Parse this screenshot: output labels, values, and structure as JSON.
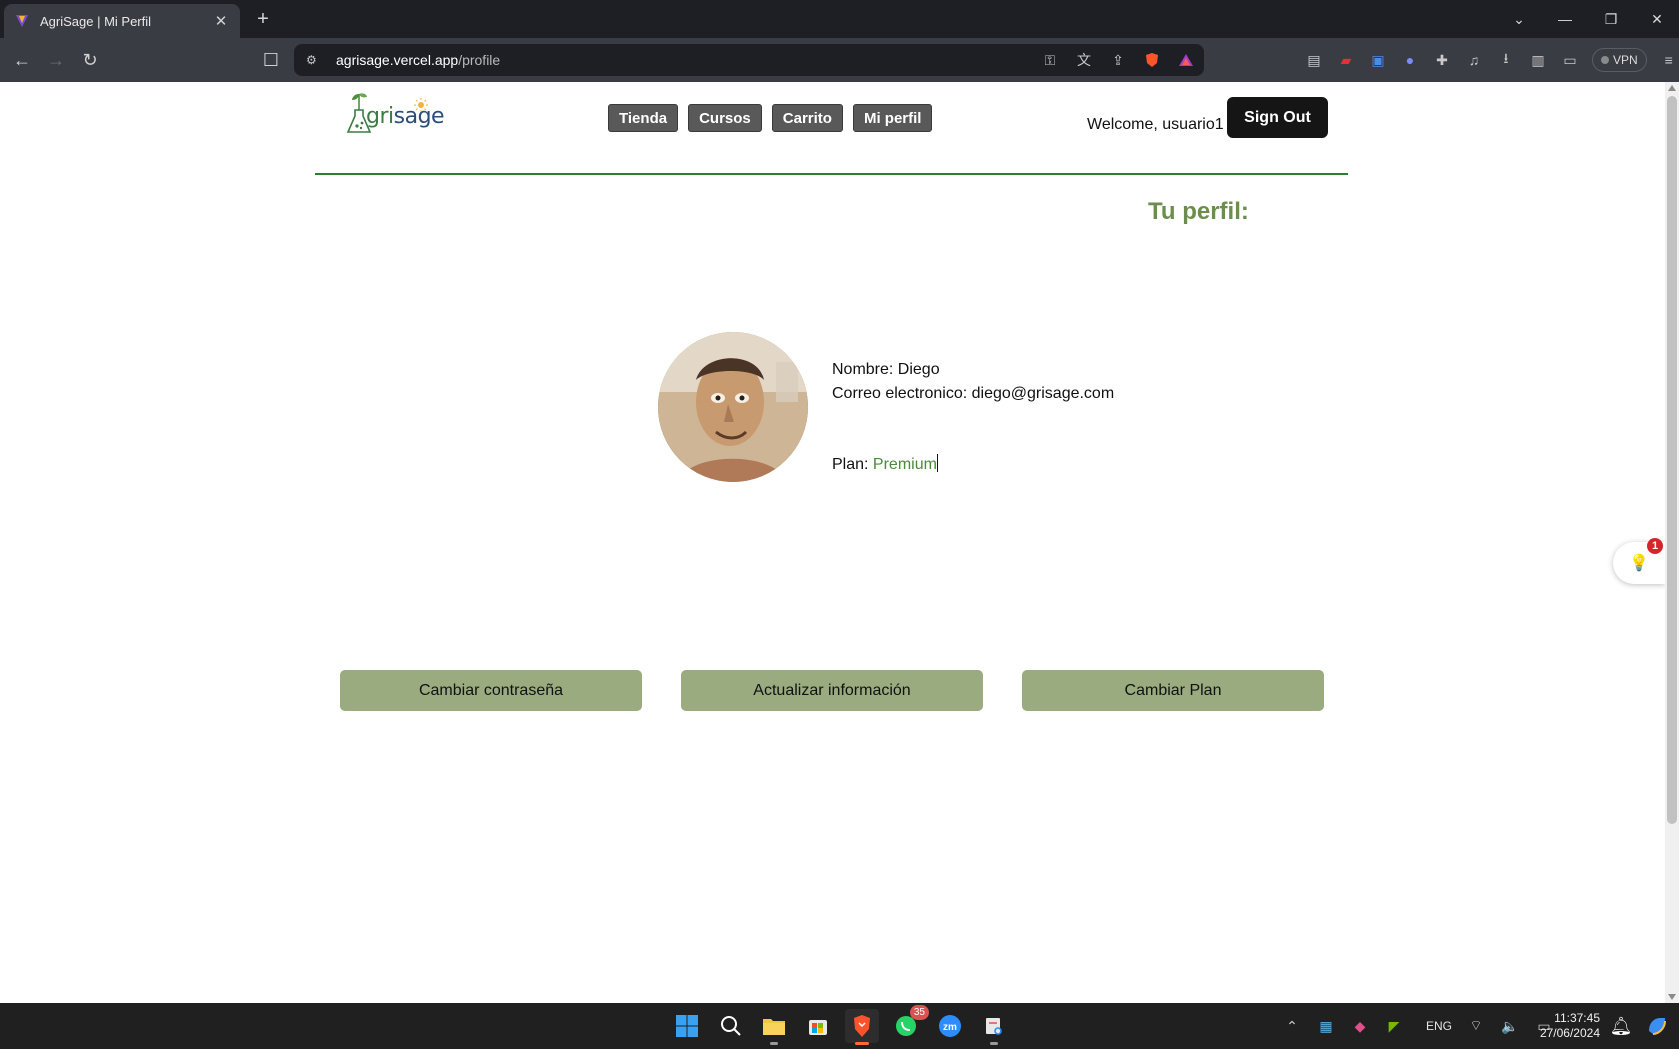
{
  "browser": {
    "tab_title": "AgriSage | Mi Perfil",
    "url_host": "agrisage.vercel.app",
    "url_path": "/profile",
    "vpn_label": "VPN"
  },
  "site": {
    "logo_text_left": "A",
    "logo_text_mid": "gri",
    "logo_text_right": "sage",
    "nav": [
      "Tienda",
      "Cursos",
      "Carrito",
      "Mi perfil"
    ],
    "welcome": "Welcome, usuario1",
    "sign_out": "Sign Out",
    "heading": "Tu perfil:"
  },
  "profile": {
    "name_line": "Nombre: Diego",
    "email_line": "Correo electronico: diego@grisage.com",
    "plan_label": "Plan: ",
    "plan_value": "Premium"
  },
  "actions": [
    "Cambiar contraseña",
    "Actualizar información",
    "Cambiar Plan"
  ],
  "widget": {
    "badge": "1"
  },
  "taskbar": {
    "whatsapp_badge": "35",
    "language": "ENG",
    "time": "11:37:45",
    "date": "27/06/2024"
  },
  "colors": {
    "accent_green": "#2e7d32",
    "heading_green": "#6b8e4e",
    "button_green": "#9aab80",
    "plan_green": "#4a8a3a"
  }
}
